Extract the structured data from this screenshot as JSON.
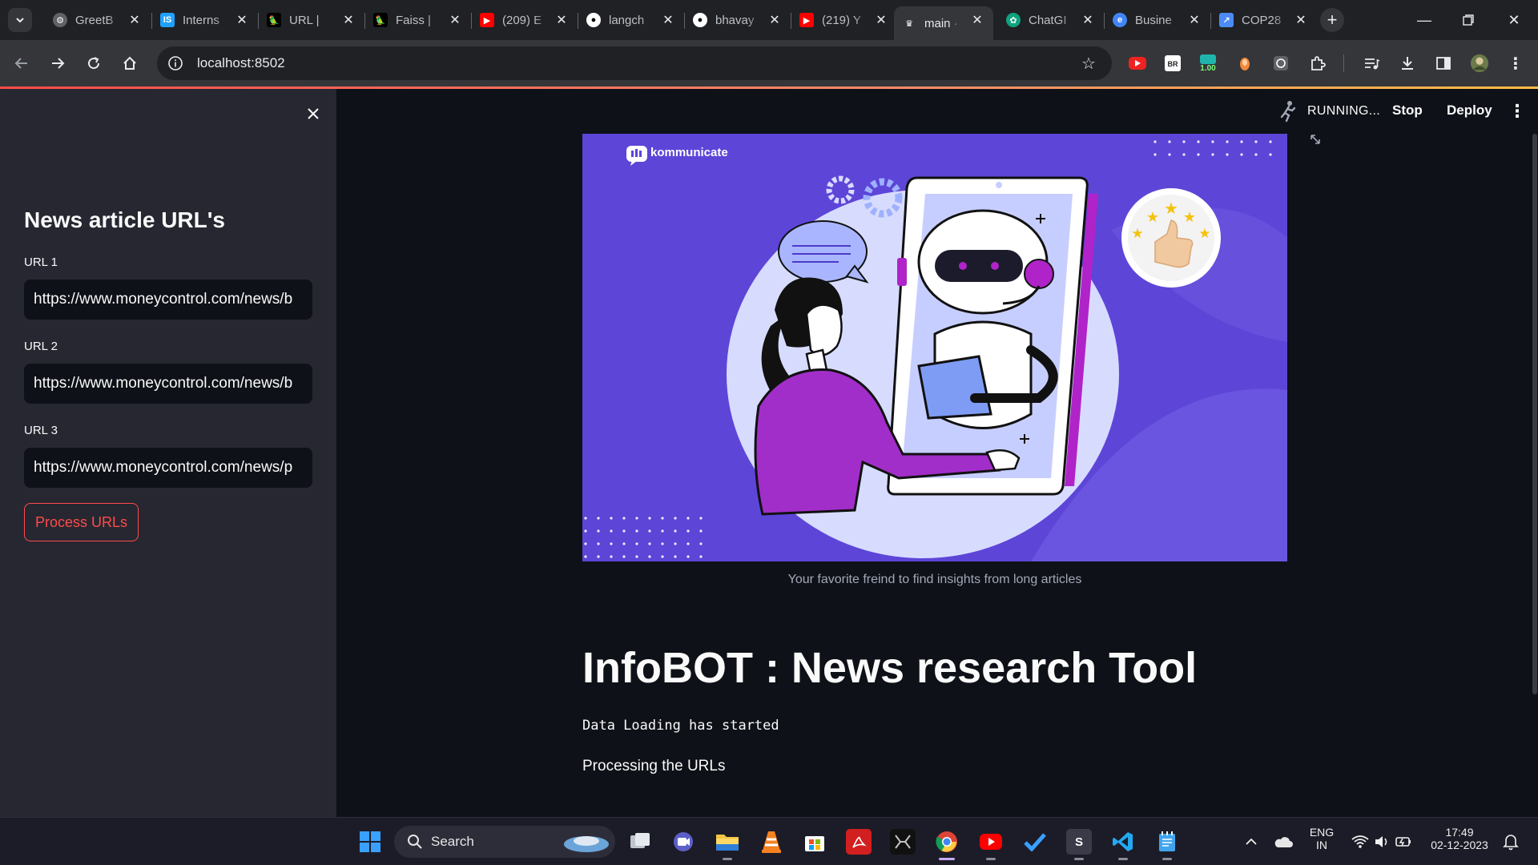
{
  "browser": {
    "tabs": [
      {
        "title": "GreetB",
        "favicon": "colorful-gear-icon",
        "color": "#5f6368"
      },
      {
        "title": "Interns",
        "favicon": "internshala-icon",
        "color": "#1fa2ff"
      },
      {
        "title": "URL | ",
        "favicon": "langchain-icon",
        "color": "#000000"
      },
      {
        "title": "Faiss | ",
        "favicon": "langchain-icon",
        "color": "#000000"
      },
      {
        "title": "(209) E",
        "favicon": "youtube-icon",
        "color": "#ff0000"
      },
      {
        "title": "langch",
        "favicon": "github-icon",
        "color": "#ffffff"
      },
      {
        "title": "bhavay",
        "favicon": "github-icon",
        "color": "#ffffff"
      },
      {
        "title": "(219) Y",
        "favicon": "youtube-icon",
        "color": "#ff0000"
      },
      {
        "title": "main ·",
        "favicon": "streamlit-icon",
        "color": "#ff4b4b"
      },
      {
        "title": "ChatGI",
        "favicon": "chatgpt-icon",
        "color": "#10a37f"
      },
      {
        "title": "Busine",
        "favicon": "business-icon",
        "color": "#4285f4"
      },
      {
        "title": "COP28",
        "favicon": "cop28-icon",
        "color": "#4c8bf5"
      }
    ],
    "active_tab_index": 8,
    "address": "localhost:8502",
    "extension_badge": "1.00"
  },
  "sidebar": {
    "title": "News article URL's",
    "fields": [
      {
        "label": "URL 1",
        "value": "https://www.moneycontrol.com/news/b"
      },
      {
        "label": "URL 2",
        "value": "https://www.moneycontrol.com/news/b"
      },
      {
        "label": "URL 3",
        "value": "https://www.moneycontrol.com/news/p"
      }
    ],
    "button_label": "Process URLs"
  },
  "header": {
    "status": "RUNNING...",
    "stop_label": "Stop",
    "deploy_label": "Deploy"
  },
  "main": {
    "hero_brand": "kommunicate",
    "caption": "Your favorite freind to find insights from long articles",
    "title": "InfoBOT : News research Tool",
    "code_line": "Data Loading has started",
    "paragraph": "Processing the URLs"
  },
  "taskbar": {
    "search_label": "Search",
    "lang_top": "ENG",
    "lang_bottom": "IN",
    "time": "17:49",
    "date": "02-12-2023"
  },
  "colors": {
    "accent": "#ff4b4b",
    "hero_bg": "#5d45d8",
    "sidebar_bg": "#262730",
    "app_bg": "#0e1117"
  }
}
